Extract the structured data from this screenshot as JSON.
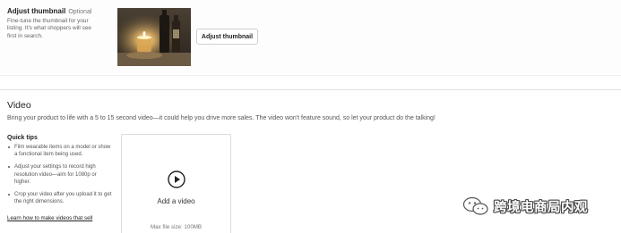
{
  "thumbnail": {
    "title": "Adjust thumbnail",
    "optional_label": "Optional",
    "description": "Fine-tune the thumbnail for your listing. It's what shoppers will see first in search.",
    "image_alt": "candle-and-bottle-photo",
    "button_label": "Adjust thumbnail"
  },
  "video": {
    "title": "Video",
    "description": "Bring your product to life with a 5 to 15 second video—it could help you drive more sales. The video won't feature sound, so let your product do the talking!",
    "tips_title": "Quick tips",
    "tips": [
      "Film wearable items on a model or show a functional item being used.",
      "Adjust your settings to record high resolution video—aim for 1080p or higher.",
      "Crop your video after you upload it to get the right dimensions."
    ],
    "learn_link": "Learn how to make videos that sell",
    "upload": {
      "icon": "play-icon",
      "label": "Add a video",
      "max_size": "Max file size: 100MB"
    }
  },
  "watermark": {
    "icon": "wechat-logo",
    "text": "跨境电商局内观"
  }
}
